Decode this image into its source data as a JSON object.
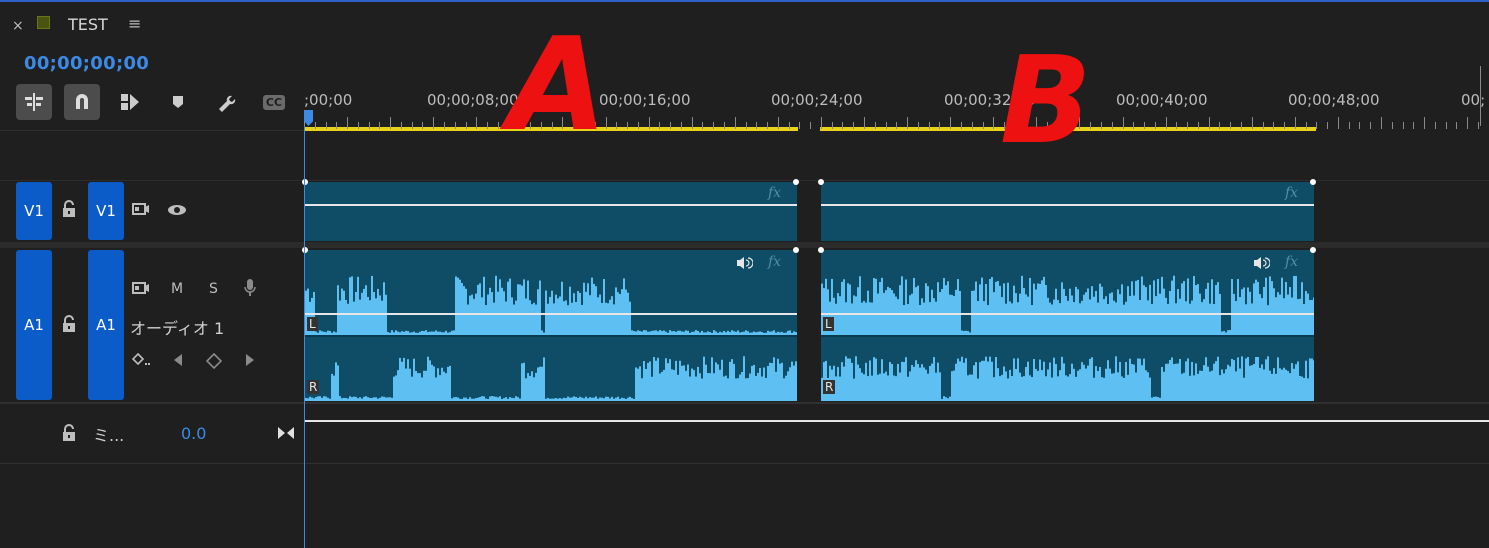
{
  "panel": {
    "close": "×",
    "title": "TEST",
    "menu": "≡",
    "swatch_color": "#4a5410"
  },
  "timecode": "00;00;00;00",
  "toolbar": [
    {
      "name": "insert-nest-icon",
      "active": true
    },
    {
      "name": "snap-magnet-icon",
      "active": true
    },
    {
      "name": "linked-selection-icon",
      "active": false
    },
    {
      "name": "add-marker-icon",
      "active": false
    },
    {
      "name": "timeline-settings-wrench-icon",
      "active": false
    },
    {
      "name": "captions-icon",
      "label": "CC",
      "active": false
    }
  ],
  "ruler": {
    "labels": [
      ";00;00",
      "00;00;08;00",
      "00;00;16;00",
      "00;00;24;00",
      "00;00;32;00",
      "00;00;40;00",
      "00;00;48;00",
      "00;"
    ]
  },
  "tracks": {
    "v1": {
      "source_label": "V1",
      "target_label": "V1"
    },
    "a1": {
      "source_label": "A1",
      "target_label": "A1",
      "name": "オーディオ 1",
      "mute": "M",
      "solo": "S"
    },
    "mix": {
      "name": "ミ...",
      "value": "0.0"
    }
  },
  "clips": {
    "fx_label": "fx",
    "left_channel": "L",
    "right_channel": "R"
  },
  "annotations": [
    "A",
    "B"
  ],
  "colors": {
    "accent_blue": "#3d8ae6",
    "track_button": "#0b5bc9",
    "clip_fill": "#0f4d66",
    "waveform": "#5ec0f2",
    "workbar": "#e8d31a",
    "annotation_red": "#ee1111"
  }
}
